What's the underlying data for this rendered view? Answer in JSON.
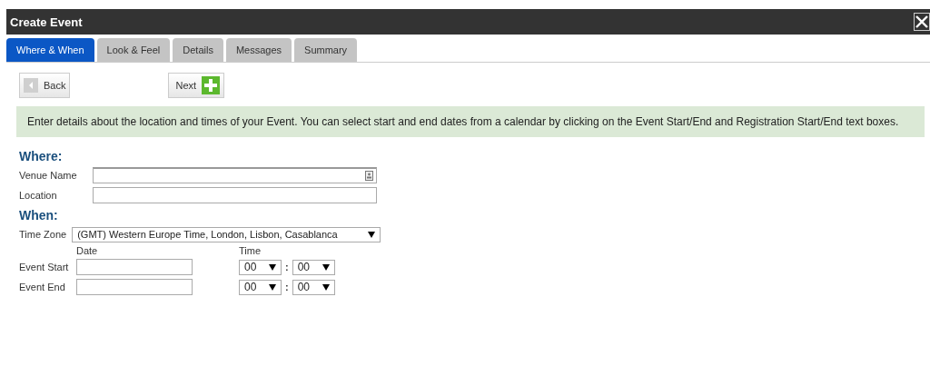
{
  "window": {
    "title": "Create Event"
  },
  "tabs": [
    {
      "label": "Where & When",
      "selected": true
    },
    {
      "label": "Look & Feel",
      "selected": false
    },
    {
      "label": "Details",
      "selected": false
    },
    {
      "label": "Messages",
      "selected": false
    },
    {
      "label": "Summary",
      "selected": false
    }
  ],
  "buttons": {
    "back": "Back",
    "next": "Next"
  },
  "info": "Enter details about the location and times of your Event. You can select start and end dates from a calendar by clicking on the Event Start/End and Registration Start/End text boxes.",
  "where": {
    "heading": "Where:",
    "venue_label": "Venue Name",
    "location_label": "Location"
  },
  "when": {
    "heading": "When:",
    "timezone_label": "Time Zone",
    "timezone": "(GMT) Western Europe Time, London, Lisbon, Casablanca",
    "date_header": "Date",
    "time_header": "Time",
    "rows": [
      {
        "label": "Event Start",
        "hour": "00",
        "separator": ":",
        "minute": "00"
      },
      {
        "label": "Event End",
        "hour": "00",
        "separator": ":",
        "minute": "00"
      }
    ]
  }
}
